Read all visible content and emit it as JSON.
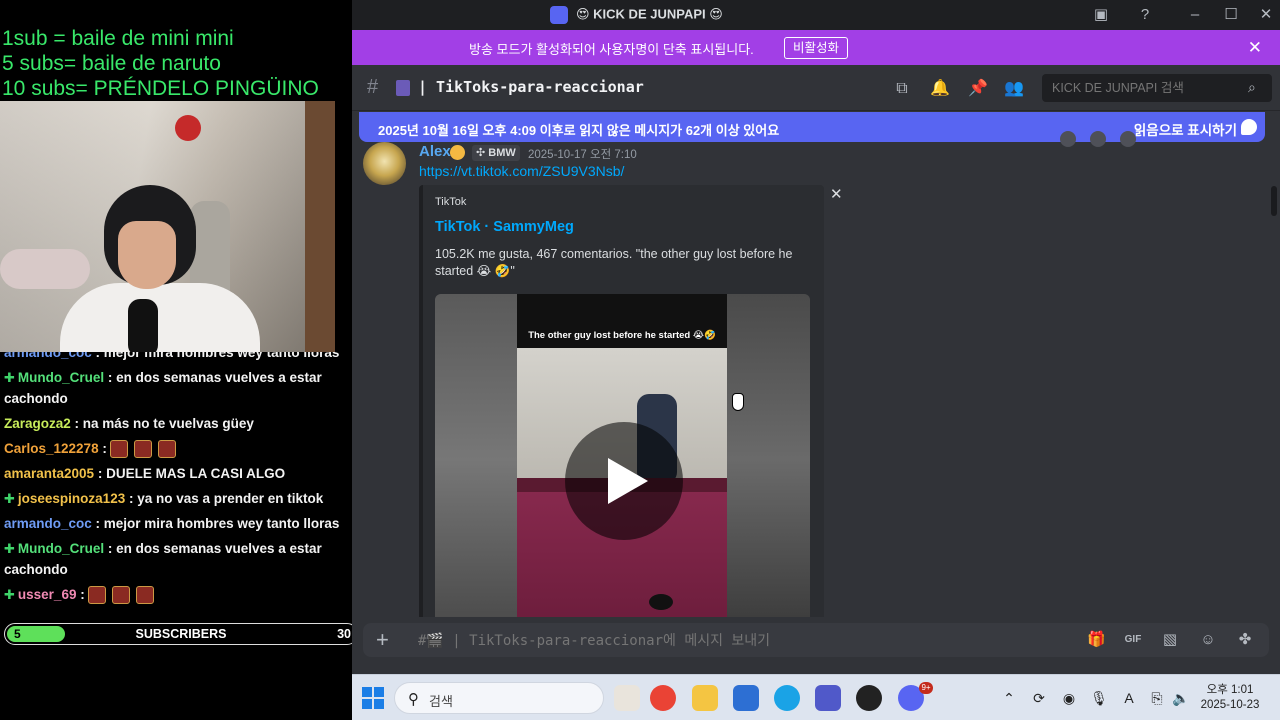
{
  "overlay": {
    "goals": [
      "1sub = baile de mini mini",
      "5 subs= baile de naruto",
      "10 subs= PRÉNDELO PINGÜINO"
    ],
    "chat": [
      {
        "user": "armando_coc",
        "text": ": mejor mira hombres wey tanto lloras",
        "color": "#6f9cf5",
        "badge": false
      },
      {
        "user": "Mundo_Cruel",
        "text": ": en dos semanas vuelves a estar cachondo",
        "color": "#54e07a",
        "badge": true
      },
      {
        "user": "Zaragoza2",
        "text": ": na más no te vuelvas güey",
        "color": "#c7ec5a",
        "badge": false
      },
      {
        "user": "Carlos_122278",
        "text": ":",
        "color": "#f0a23a",
        "badge": false,
        "emotes": 3
      },
      {
        "user": "amaranta2005",
        "text": ": DUELE MAS LA CASI ALGO",
        "color": "#f1c14a",
        "badge": false
      },
      {
        "user": "joseespinoza123",
        "text": ": ya no vas a prender en tiktok",
        "color": "#f1c14a",
        "badge": true
      },
      {
        "user": "armando_coc",
        "text": ": mejor mira hombres wey tanto lloras",
        "color": "#6f9cf5",
        "badge": false
      },
      {
        "user": "Mundo_Cruel",
        "text": ": en dos semanas vuelves a estar cachondo",
        "color": "#54e07a",
        "badge": true
      },
      {
        "user": "usser_69",
        "text": ":",
        "color": "#f08ab3",
        "badge": true,
        "emotes": 3
      }
    ],
    "subs": {
      "current": "5",
      "label": "SUBSCRIBERS",
      "goal": "30",
      "progress": 0.1667
    }
  },
  "window": {
    "title": "KICK DE JUNPAPI"
  },
  "banner": {
    "text": "방송 모드가 활성화되어 사용자명이 단축 표시됩니다.",
    "button": "비활성화"
  },
  "channel": {
    "name": "| TikToks-para-reaccionar",
    "search_placeholder": "KICK DE JUNPAPI 검색"
  },
  "unread": {
    "text": "2025년 10월 16일 오후 4:09 이후로 읽지 않은 메시지가 62개 이상 있어요",
    "mark_read": "읽음으로 표시하기"
  },
  "message": {
    "author": "Alex",
    "tag": "BMW",
    "timestamp": "2025-10-17 오전 7:10",
    "link": "https://vt.tiktok.com/ZSU9V3Nsb/",
    "embed": {
      "provider": "TikTok",
      "title": "TikTok · SammyMeg",
      "description": "105.2K me gusta, 467 comentarios. \"the other guy lost before he started 😭 🤣\"",
      "video_caption": "The other guy lost before he started 😭🤣"
    }
  },
  "composer": {
    "placeholder": "#🎬 | TikToks-para-reaccionar에 메시지 보내기"
  },
  "taskbar": {
    "search_label": "검색",
    "time": "오후 1:01",
    "date": "2025-10-23",
    "discord_badge": "9+"
  },
  "colors": {
    "banner": "#a23fe6",
    "unread_bar": "#5865f2",
    "link": "#00a8fc",
    "goal_text": "#39e86a"
  }
}
